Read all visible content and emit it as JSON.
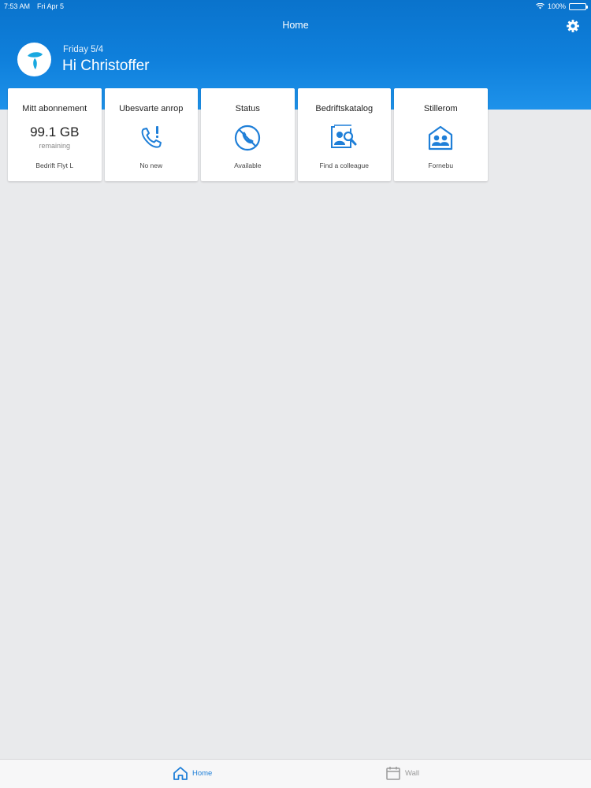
{
  "status_bar": {
    "time": "7:53 AM",
    "date": "Fri Apr 5",
    "battery": "100%"
  },
  "nav": {
    "title": "Home",
    "settings_icon": "gear-icon"
  },
  "greeting": {
    "date": "Friday 5/4",
    "name": "Hi Christoffer",
    "logo_icon": "telenor-logo-icon"
  },
  "tiles": [
    {
      "title": "Mitt abonnement",
      "value": "99.1 GB",
      "value_caption": "remaining",
      "subtitle": "Bedrift Flyt L"
    },
    {
      "title": "Ubesvarte anrop",
      "subtitle": "No new",
      "icon": "missed-call-icon"
    },
    {
      "title": "Status",
      "subtitle": "Available",
      "icon": "status-phone-icon"
    },
    {
      "title": "Bedriftskatalog",
      "subtitle": "Find a colleague",
      "icon": "directory-search-icon"
    },
    {
      "title": "Stillerom",
      "subtitle": "Fornebu",
      "icon": "quiet-room-icon"
    }
  ],
  "tabbar": [
    {
      "label": "Home",
      "icon": "home-icon",
      "active": true
    },
    {
      "label": "Wall",
      "icon": "calendar-icon",
      "active": false
    }
  ],
  "colors": {
    "brand": "#0f80dc",
    "accent": "#1f7fd8",
    "background": "#e9eaec"
  }
}
